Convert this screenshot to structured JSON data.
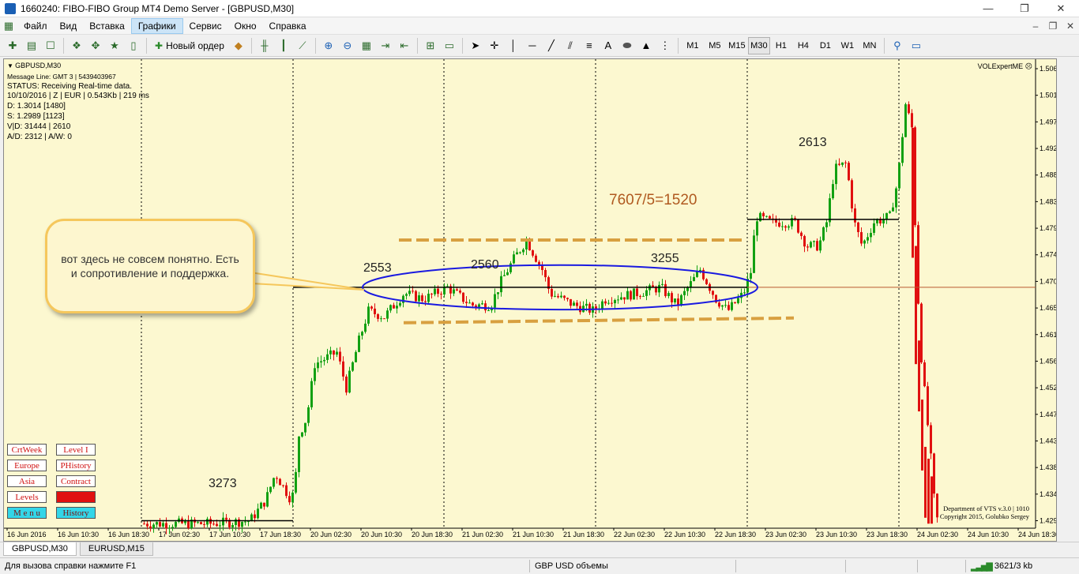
{
  "window": {
    "title": "1660240: FIBO-FIBO Group MT4 Demo Server - [GBPUSD,M30]",
    "min": "—",
    "max": "❐",
    "close": "✕"
  },
  "menu": {
    "items": [
      "Файл",
      "Вид",
      "Вставка",
      "Графики",
      "Сервис",
      "Окно",
      "Справка"
    ],
    "active_index": 3
  },
  "toolbar": {
    "new_order": "Новый ордер",
    "timeframes": [
      "M1",
      "M5",
      "M15",
      "M30",
      "H1",
      "H4",
      "D1",
      "W1",
      "MN"
    ],
    "active_tf": "M30"
  },
  "info": {
    "symbol": "GBPUSD,M30",
    "lines": [
      "Message Line: GMT 3 | 5439403967",
      "STATUS:  Receiving Real-time data.",
      "10/10/2016 | Z | EUR | 0.543Kb | 219 ms",
      "D: 1.3014  [1480]",
      "S: 1.2989  [1123]",
      "V|D: 31444 | 2610",
      "A/D: 2312 | A/W: 0"
    ],
    "expert": "VOLExpertME"
  },
  "annotations": {
    "bubble": "вот здесь не совсем понятно. Есть и сопротивление и поддержка.",
    "ratio": "7607/5=1520",
    "labels": [
      {
        "text": "2553"
      },
      {
        "text": "2560"
      },
      {
        "text": "3255"
      },
      {
        "text": "2613"
      },
      {
        "text": "3273"
      }
    ]
  },
  "panel_buttons": [
    [
      "CrtWeek",
      "Level I"
    ],
    [
      "Europe",
      "PHistory"
    ],
    [
      "Asia",
      "Contract"
    ],
    [
      "Levels",
      ""
    ],
    [
      "M e n u",
      "History"
    ]
  ],
  "copyright": [
    "Department of VTS  v.3.0 | 1010",
    "Copyright 2015, Golubko Sergey"
  ],
  "chart_data": {
    "type": "candlestick",
    "symbol": "GBPUSD",
    "timeframe": "M30",
    "price_ticks": [
      "1.5060",
      "1.5015",
      "1.4970",
      "1.4925",
      "1.4880",
      "1.4835",
      "1.4790",
      "1.4745",
      "1.4700",
      "1.4655",
      "1.4610",
      "1.4565",
      "1.4520",
      "1.4475",
      "1.4430",
      "1.4385",
      "1.4340",
      "1.4295"
    ],
    "ylim": [
      1.4285,
      1.508
    ],
    "current_price": 1.469,
    "time_ticks": [
      "16 Jun 2016",
      "16 Jun 10:30",
      "16 Jun 18:30",
      "17 Jun 02:30",
      "17 Jun 10:30",
      "17 Jun 18:30",
      "20 Jun 02:30",
      "20 Jun 10:30",
      "20 Jun 18:30",
      "21 Jun 02:30",
      "21 Jun 10:30",
      "21 Jun 18:30",
      "22 Jun 02:30",
      "22 Jun 10:30",
      "22 Jun 18:30",
      "23 Jun 02:30",
      "23 Jun 10:30",
      "23 Jun 18:30",
      "24 Jun 02:30",
      "24 Jun 10:30",
      "24 Jun 18:30"
    ],
    "colors": {
      "bull": "#12a012",
      "bear": "#e01010",
      "bg": "#fcf8d0",
      "dash": "#d8a040",
      "ellipse": "#1a1ae0",
      "price_line": "#b85a30"
    }
  },
  "tabs": [
    "GBPUSD,M30",
    "EURUSD,M15"
  ],
  "status": {
    "help": "Для вызова справки нажмите F1",
    "profile": "GBP USD объемы",
    "traffic": "3621/3 kb"
  }
}
